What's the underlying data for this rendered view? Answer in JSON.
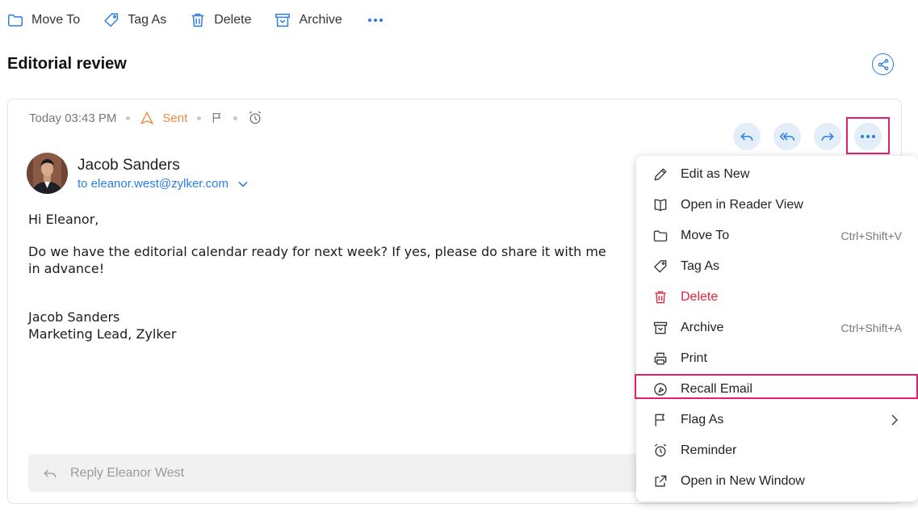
{
  "toolbar": {
    "items": [
      {
        "label": "Move To",
        "icon": "folder-icon"
      },
      {
        "label": "Tag As",
        "icon": "tag-icon"
      },
      {
        "label": "Delete",
        "icon": "trash-icon"
      },
      {
        "label": "Archive",
        "icon": "archive-icon"
      }
    ],
    "more_icon": "more-horizontal-icon"
  },
  "email": {
    "subject": "Editorial review",
    "time": "Today 03:43 PM",
    "status": "Sent",
    "sender_name": "Jacob Sanders",
    "recipient": "to eleanor.west@zylker.com",
    "body": {
      "greeting": "Hi Eleanor,",
      "line1": "Do we have the editorial calendar ready for next week? If yes, please do share it with me",
      "line2": "in advance!",
      "sig_name": "Jacob Sanders",
      "sig_title": "Marketing Lead, Zylker"
    },
    "reply_placeholder": "Reply Eleanor West"
  },
  "menu": {
    "items": [
      {
        "label": "Edit as New",
        "shortcut": "",
        "icon": "pencil-icon"
      },
      {
        "label": "Open in Reader View",
        "shortcut": "",
        "icon": "book-icon"
      },
      {
        "label": "Move To",
        "shortcut": "Ctrl+Shift+V",
        "icon": "folder-icon"
      },
      {
        "label": "Tag As",
        "shortcut": "",
        "icon": "tag-icon"
      },
      {
        "label": "Delete",
        "shortcut": "",
        "icon": "trash-icon"
      },
      {
        "label": "Archive",
        "shortcut": "Ctrl+Shift+A",
        "icon": "archive-icon"
      },
      {
        "label": "Print",
        "shortcut": "",
        "icon": "printer-icon"
      },
      {
        "label": "Recall Email",
        "shortcut": "",
        "icon": "recall-icon"
      },
      {
        "label": "Flag As",
        "shortcut": "",
        "icon": "flag-icon"
      },
      {
        "label": "Reminder",
        "shortcut": "",
        "icon": "alarm-icon"
      },
      {
        "label": "Open in New Window",
        "shortcut": "",
        "icon": "external-link-icon"
      }
    ]
  },
  "colors": {
    "accent": "#2a7de1",
    "sent": "#f0883a",
    "danger": "#e0233a",
    "highlight": "#e0206a"
  }
}
